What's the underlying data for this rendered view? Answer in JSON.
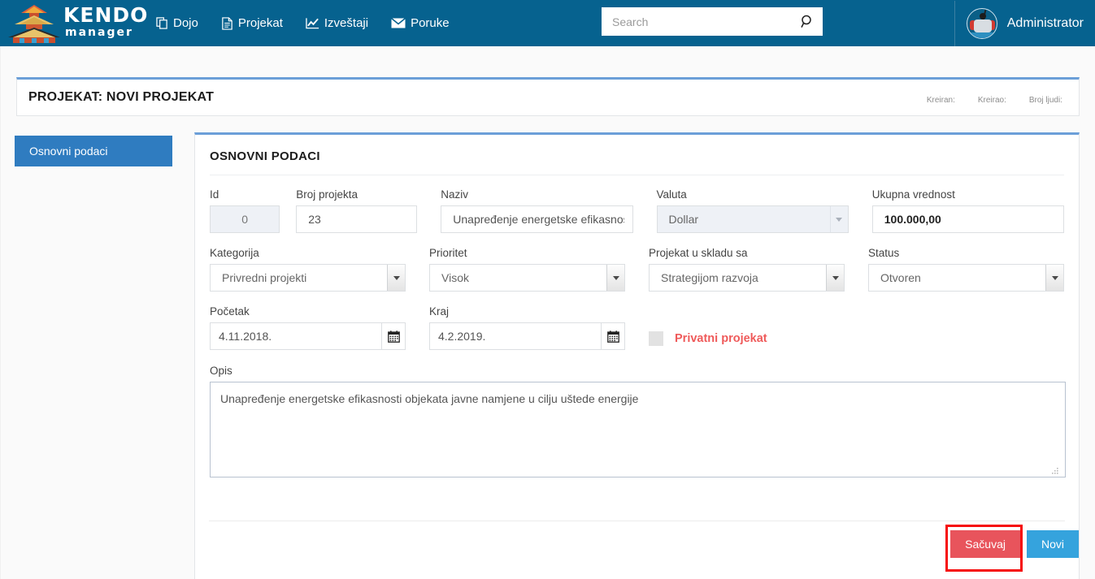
{
  "app": {
    "logo_primary": "KENDO",
    "logo_secondary": "manager",
    "header_bg": "#06628f",
    "accent_blue": "#2f7cc0",
    "panel_top_border": "#6b9fd8"
  },
  "nav": {
    "items": [
      {
        "label": "Dojo",
        "icon": "copy-icon"
      },
      {
        "label": "Projekat",
        "icon": "document-icon"
      },
      {
        "label": "Izveštaji",
        "icon": "chart-line-icon"
      },
      {
        "label": "Poruke",
        "icon": "envelope-icon"
      }
    ]
  },
  "search": {
    "placeholder": "Search",
    "value": "",
    "icon": "search-icon"
  },
  "user": {
    "name": "Administrator",
    "avatar": "kendo-fighter-avatar"
  },
  "title_card": {
    "title": "PROJEKAT: NOVI PROJEKAT",
    "meta": [
      {
        "label": "Kreiran:",
        "value": ""
      },
      {
        "label": "Kreirao:",
        "value": ""
      },
      {
        "label": "Broj ljudi:",
        "value": ""
      }
    ]
  },
  "sidebar": {
    "items": [
      {
        "label": "Osnovni podaci",
        "active": true
      }
    ]
  },
  "panel": {
    "heading": "OSNOVNI PODACI"
  },
  "form": {
    "id": {
      "label": "Id",
      "value": "0",
      "disabled": true
    },
    "broj_projekta": {
      "label": "Broj projekta",
      "value": "23"
    },
    "naziv": {
      "label": "Naziv",
      "value": "Unapređenje energetske efikasnost"
    },
    "valuta": {
      "label": "Valuta",
      "value": "Dollar",
      "disabled": true
    },
    "ukupna_vrednost": {
      "label": "Ukupna vrednost",
      "value": "100.000,00"
    },
    "kategorija": {
      "label": "Kategorija",
      "value": "Privredni projekti"
    },
    "prioritet": {
      "label": "Prioritet",
      "value": "Visok"
    },
    "u_skladu_sa": {
      "label": "Projekat u skladu sa",
      "value": "Strategijom razvoja"
    },
    "status": {
      "label": "Status",
      "value": "Otvoren"
    },
    "pocetak": {
      "label": "Početak",
      "value": "4.11.2018.",
      "icon": "calendar-icon"
    },
    "kraj": {
      "label": "Kraj",
      "value": "4.2.2019.",
      "icon": "calendar-icon"
    },
    "privatni": {
      "label": "Privatni projekat",
      "checked": false,
      "color": "#ef5a5a"
    },
    "opis": {
      "label": "Opis",
      "value": "Unapređenje energetske efikasnosti objekata javne namjene u cilju uštede energije"
    }
  },
  "actions": {
    "save": {
      "label": "Sačuvaj",
      "color": "#e8545c"
    },
    "new": {
      "label": "Novi",
      "color": "#35a3dd"
    }
  }
}
